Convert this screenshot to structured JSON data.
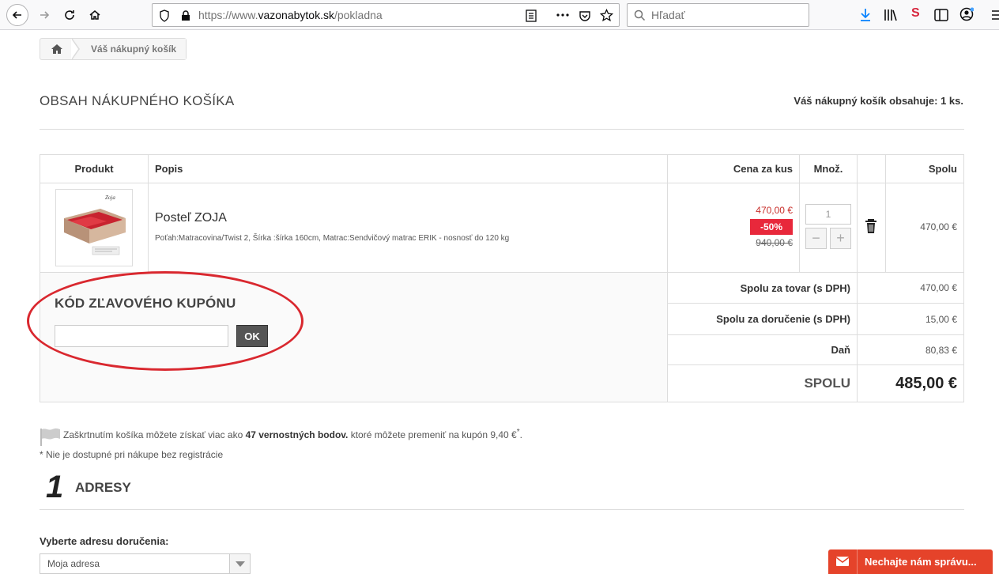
{
  "browser": {
    "url_prefix": "https://www.",
    "url_domain": "vazonabytok.sk",
    "url_path": "/pokladna",
    "search_placeholder": "Hľadať"
  },
  "breadcrumb": {
    "current": "Váš nákupný košík"
  },
  "header": {
    "title": "OBSAH NÁKUPNÉHO KOŠÍKA",
    "count_text": "Váš nákupný košík obsahuje: 1 ks."
  },
  "table": {
    "columns": {
      "product": "Produkt",
      "description": "Popis",
      "unit_price": "Cena za kus",
      "qty": "Množ.",
      "total": "Spolu"
    },
    "item": {
      "name": "Posteľ ZOJA",
      "description": "Poťah:Matracovina/Twist 2, Šírka :šírka 160cm, Matrac:Sendvičový matrac ERIK - nosnosť do 120 kg",
      "price_new": "470,00 €",
      "discount": "-50%",
      "price_old": "940,00 €",
      "qty": "1",
      "minus": "−",
      "plus": "+",
      "total": "470,00 €",
      "image_caption": "Zoja"
    },
    "summary": {
      "goods_label": "Spolu za tovar (s DPH)",
      "goods_value": "470,00 €",
      "delivery_label": "Spolu za doručenie (s DPH)",
      "delivery_value": "15,00 €",
      "tax_label": "Daň",
      "tax_value": "80,83 €",
      "total_label": "SPOLU",
      "total_value": "485,00 €"
    }
  },
  "coupon": {
    "title": "KÓD ZĽAVOVÉHO KUPÓNU",
    "button": "OK"
  },
  "loyalty": {
    "prefix": "Zaškrtnutím košíka môžete získať viac ako ",
    "points": "47 vernostných bodov.",
    "suffix": " ktoré môžete premeniť na kupón 9,40 €",
    "asterisk": "*",
    "note": "* Nie je dostupné pri nákupe bez registrácie"
  },
  "step": {
    "number": "1",
    "title": "ADRESY"
  },
  "address": {
    "label": "Vyberte adresu doručenia:",
    "selected": "Moja adresa"
  },
  "chat": {
    "label": "Nechajte nám správu..."
  },
  "colors": {
    "discount_red": "#e8283b",
    "annotation_red": "#d9282f",
    "chat_orange": "#e5432a"
  }
}
